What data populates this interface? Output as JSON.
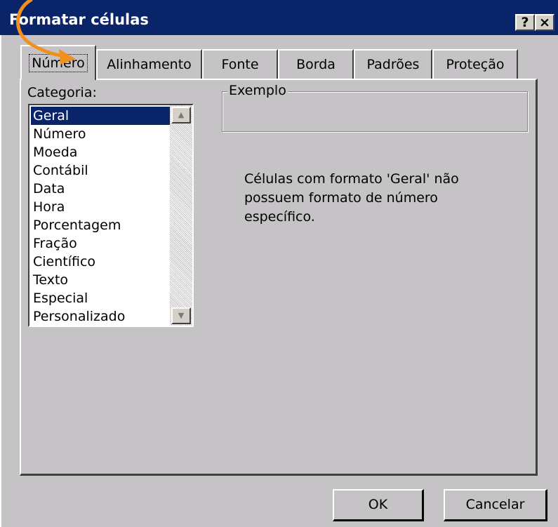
{
  "window": {
    "title": "Formatar células",
    "help_label": "?",
    "close_label": "×"
  },
  "tabs": [
    {
      "label": "Número",
      "active": true
    },
    {
      "label": "Alinhamento",
      "active": false
    },
    {
      "label": "Fonte",
      "active": false
    },
    {
      "label": "Borda",
      "active": false
    },
    {
      "label": "Padrões",
      "active": false
    },
    {
      "label": "Proteção",
      "active": false
    }
  ],
  "category": {
    "label": "Categoria:",
    "items": [
      "Geral",
      "Número",
      "Moeda",
      "Contábil",
      "Data",
      "Hora",
      "Porcentagem",
      "Fração",
      "Científico",
      "Texto",
      "Especial",
      "Personalizado"
    ],
    "selected": "Geral"
  },
  "example": {
    "label": "Exemplo"
  },
  "description": "Células com formato 'Geral' não possuem formato de número específico.",
  "buttons": {
    "ok": "OK",
    "cancel": "Cancelar"
  },
  "colors": {
    "titlebar": "#0a246a",
    "face": "#c6c3c6",
    "highlight": "#0a246a",
    "annotation_arrow": "#f0901e"
  }
}
